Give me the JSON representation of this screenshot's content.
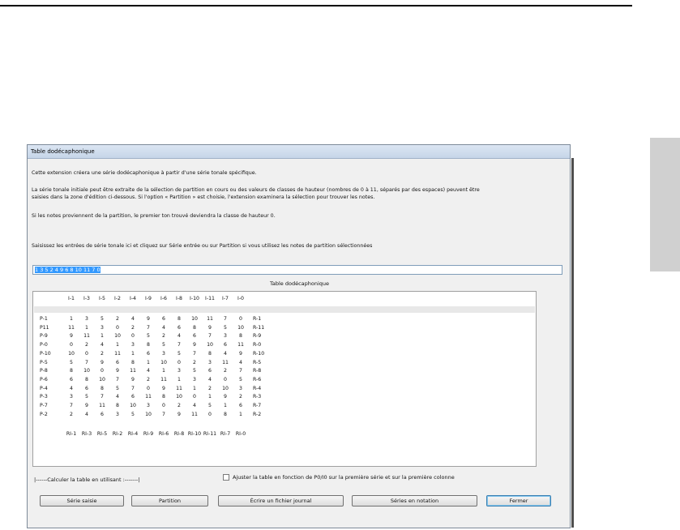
{
  "dialog": {
    "title": "Table dodécaphonique",
    "intro": "Cette extension créera une série dodécaphonique à partir d'une série tonale spécifique.",
    "para2_line1": "La série tonale initiale peut être extraite de la sélection de partition en cours ou des valeurs de classes de hauteur (nombres de 0 à 11, séparés par des espaces) peuvent être",
    "para2_line2": "saisies dans la zone d'édition ci-dessous. Si l'option « Partition » est choisie, l'extension examinera la sélection pour trouver les notes.",
    "para3": "Si les notes proviennent de la partition, le premier ton trouvé deviendra la classe de hauteur 0.",
    "instruction": "Saisissez les entrées de série tonale ici et cliquez sur Série entrée ou sur Partition si vous utilisez les notes de partition sélectionnées",
    "series_value": "1 3 5 2 4 9 6 8 10 11 7 0",
    "table_title": "Table dodécaphonique",
    "calc_label": "|------Calculer la table en utilisant :-------|",
    "adjust_label": "Ajuster la table en fonction de P0/I0 sur la première série et sur la première colonne"
  },
  "matrix": {
    "col_headers": [
      "I-1",
      "I-3",
      "I-5",
      "I-2",
      "I-4",
      "I-9",
      "I-6",
      "I-8",
      "I-10",
      "I-11",
      "I-7",
      "I-0"
    ],
    "footer_headers": [
      "RI-1",
      "RI-3",
      "RI-5",
      "RI-2",
      "RI-4",
      "RI-9",
      "RI-6",
      "RI-8",
      "RI-10",
      "RI-11",
      "RI-7",
      "RI-0"
    ],
    "rows": [
      {
        "label": "P-1",
        "values": [
          "1",
          "3",
          "5",
          "2",
          "4",
          "9",
          "6",
          "8",
          "10",
          "11",
          "7",
          "0"
        ],
        "right": "R-1"
      },
      {
        "label": "P11",
        "values": [
          "11",
          "1",
          "3",
          "0",
          "2",
          "7",
          "4",
          "6",
          "8",
          "9",
          "5",
          "10"
        ],
        "right": "R-11"
      },
      {
        "label": "P-9",
        "values": [
          "9",
          "11",
          "1",
          "10",
          "0",
          "5",
          "2",
          "4",
          "6",
          "7",
          "3",
          "8"
        ],
        "right": "R-9"
      },
      {
        "label": "P-0",
        "values": [
          "0",
          "2",
          "4",
          "1",
          "3",
          "8",
          "5",
          "7",
          "9",
          "10",
          "6",
          "11"
        ],
        "right": "R-0"
      },
      {
        "label": "P-10",
        "values": [
          "10",
          "0",
          "2",
          "11",
          "1",
          "6",
          "3",
          "5",
          "7",
          "8",
          "4",
          "9"
        ],
        "right": "R-10"
      },
      {
        "label": "P-5",
        "values": [
          "5",
          "7",
          "9",
          "6",
          "8",
          "1",
          "10",
          "0",
          "2",
          "3",
          "11",
          "4"
        ],
        "right": "R-5"
      },
      {
        "label": "P-8",
        "values": [
          "8",
          "10",
          "0",
          "9",
          "11",
          "4",
          "1",
          "3",
          "5",
          "6",
          "2",
          "7"
        ],
        "right": "R-8"
      },
      {
        "label": "P-6",
        "values": [
          "6",
          "8",
          "10",
          "7",
          "9",
          "2",
          "11",
          "1",
          "3",
          "4",
          "0",
          "5"
        ],
        "right": "R-6"
      },
      {
        "label": "P-4",
        "values": [
          "4",
          "6",
          "8",
          "5",
          "7",
          "0",
          "9",
          "11",
          "1",
          "2",
          "10",
          "3"
        ],
        "right": "R-4"
      },
      {
        "label": "P-3",
        "values": [
          "3",
          "5",
          "7",
          "4",
          "6",
          "11",
          "8",
          "10",
          "0",
          "1",
          "9",
          "2"
        ],
        "right": "R-3"
      },
      {
        "label": "P-7",
        "values": [
          "7",
          "9",
          "11",
          "8",
          "10",
          "3",
          "0",
          "2",
          "4",
          "5",
          "1",
          "6"
        ],
        "right": "R-7"
      },
      {
        "label": "P-2",
        "values": [
          "2",
          "4",
          "6",
          "3",
          "5",
          "10",
          "7",
          "9",
          "11",
          "0",
          "8",
          "1"
        ],
        "right": "R-2"
      }
    ]
  },
  "buttons": {
    "serie_saisie": "Série saisie",
    "partition": "Partition",
    "journal": "Écrire un fichier journal",
    "notation": "Séries en notation",
    "fermer": "Fermer"
  }
}
